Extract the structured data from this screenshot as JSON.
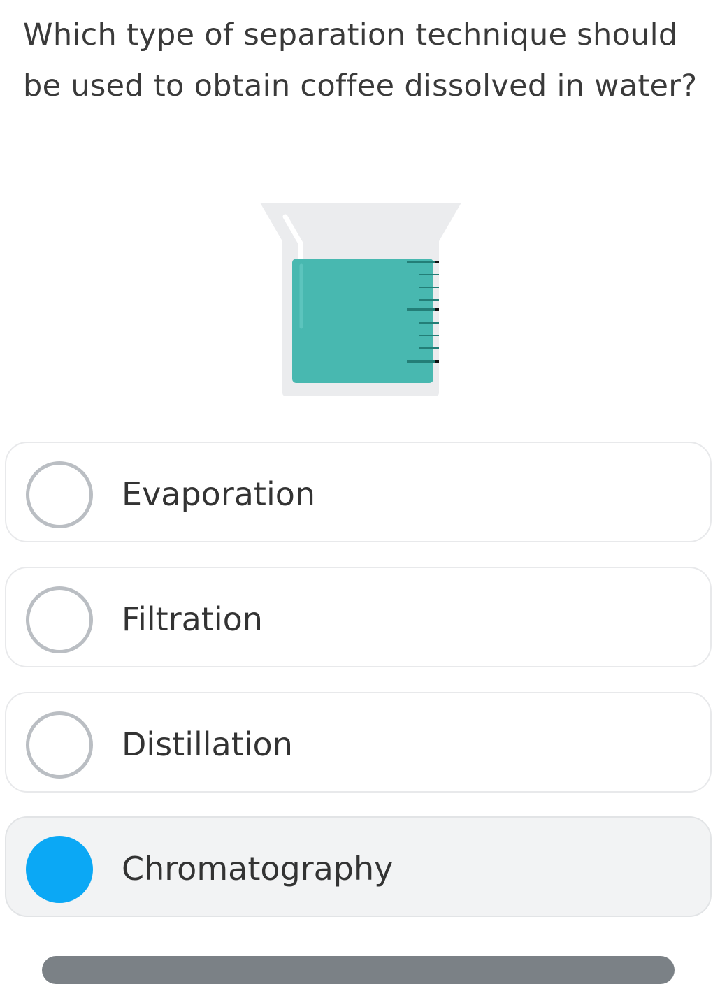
{
  "question": {
    "text": "Which type of separation technique should be used to obtain coffee dissolved in water?"
  },
  "illustration": {
    "icon": "beaker-icon",
    "liquid_color": "#48b8b0",
    "glass_color": "#ebecee"
  },
  "options": [
    {
      "label": "Evaporation",
      "selected": false
    },
    {
      "label": "Filtration",
      "selected": false
    },
    {
      "label": "Distillation",
      "selected": false
    },
    {
      "label": "Chromatography",
      "selected": true
    }
  ],
  "colors": {
    "selected_radio": "#0ba8f5",
    "unselected_radio_border": "#babec3",
    "bottom_button": "#7b8186"
  }
}
